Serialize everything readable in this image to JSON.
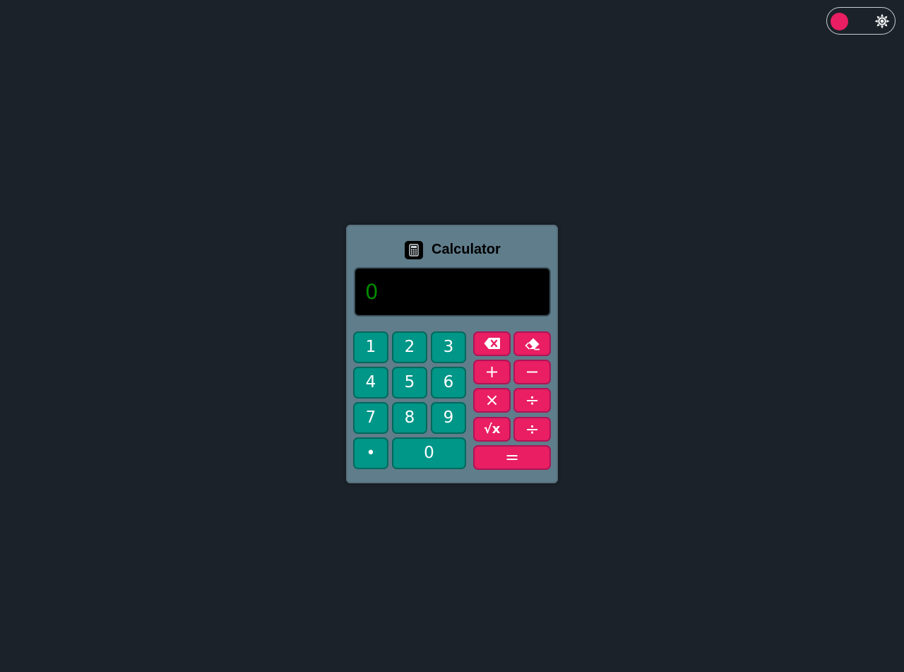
{
  "theme_toggle": {
    "knob_color": "#e91e63",
    "icon": "sun-icon"
  },
  "calculator": {
    "title": "Calculator",
    "icon": "calculator-icon",
    "display_value": "0"
  },
  "keys": {
    "one": "1",
    "two": "2",
    "three": "3",
    "four": "4",
    "five": "5",
    "six": "6",
    "seven": "7",
    "eight": "8",
    "nine": "9",
    "decimal": "•",
    "zero": "0",
    "backspace": "backspace-icon",
    "clear": "eraser-icon",
    "plus": "+",
    "minus": "−",
    "multiply": "×",
    "divide": "÷",
    "sqrt": "√x",
    "divide_second": "÷",
    "equals": "="
  },
  "colors": {
    "background": "#1b2229",
    "panel": "#607d8b",
    "number_key": "#009688",
    "operator_key": "#e91e63",
    "display_bg": "#000000",
    "display_text": "#008c00"
  }
}
